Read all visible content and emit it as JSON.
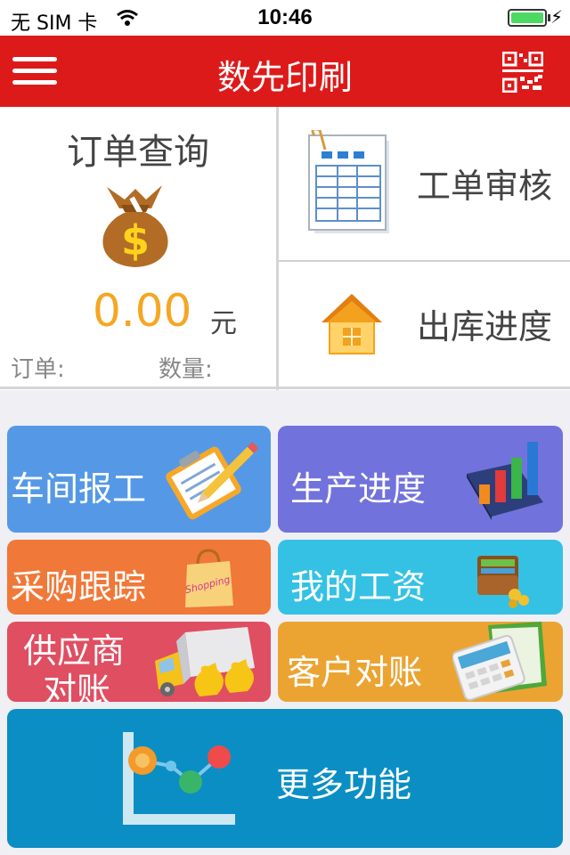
{
  "status": {
    "carrier": "无 SIM 卡",
    "time": "10:46"
  },
  "nav": {
    "title": "数先印刷"
  },
  "order": {
    "title": "订单查询",
    "amount": "0.00",
    "unit": "元",
    "order_label": "订单:",
    "qty_label": "数量:"
  },
  "right_items": [
    {
      "label": "工单审核"
    },
    {
      "label": "出库进度"
    }
  ],
  "tiles": [
    {
      "label": "车间报工",
      "color": "#5599e6"
    },
    {
      "label": "生产进度",
      "color": "#7272dc"
    },
    {
      "label": "采购跟踪",
      "color": "#f07838"
    },
    {
      "label": "我的工资",
      "color": "#35c1e3"
    },
    {
      "label_line1": "供应商",
      "label_line2": "对账",
      "color": "#e04e62"
    },
    {
      "label": "客户对账",
      "color": "#eba432"
    },
    {
      "label": "更多功能",
      "color": "#0b8ec4"
    }
  ],
  "icon_texts": {
    "shopping": "Shopping"
  }
}
